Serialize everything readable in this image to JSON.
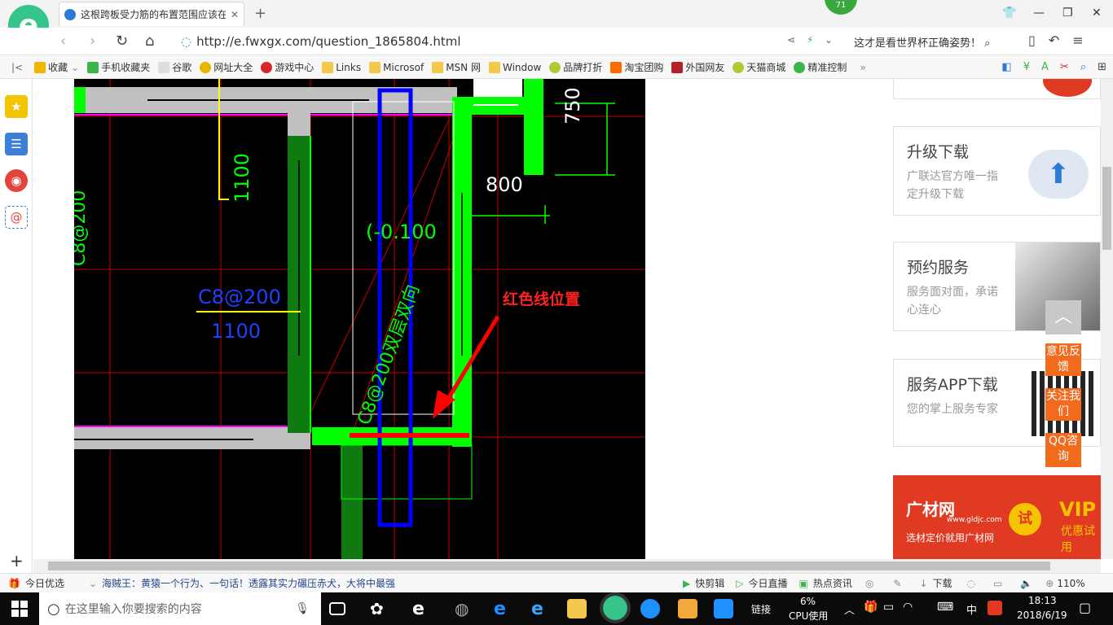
{
  "browser": {
    "tab_title": "这根跨板受力筋的布置范围应该在",
    "new_tab": "+",
    "badge": "71",
    "url": "http://e.fwxgx.com/question_1865804.html",
    "news_ticker": "这才是看世界杯正确姿势！"
  },
  "bookmarks": [
    {
      "label": "收藏",
      "color": "#f1b500"
    },
    {
      "label": "手机收藏夹",
      "color": "#3bb54a"
    },
    {
      "label": "谷歌",
      "color": "#dddddd"
    },
    {
      "label": "网址大全",
      "color": "#e6b600"
    },
    {
      "label": "游戏中心",
      "color": "#d9262c"
    },
    {
      "label": "Links",
      "color": "#f2c94c"
    },
    {
      "label": "Microsof",
      "color": "#f2c94c"
    },
    {
      "label": "MSN 网",
      "color": "#f2c94c"
    },
    {
      "label": "Window",
      "color": "#f2c94c"
    },
    {
      "label": "品牌打折",
      "color": "#b0c935"
    },
    {
      "label": "淘宝团购",
      "color": "#ff6a00"
    },
    {
      "label": "外国网友",
      "color": "#b3222b"
    },
    {
      "label": "天猫商城",
      "color": "#b0c935"
    },
    {
      "label": "精准控制",
      "color": "#3bb54a"
    }
  ],
  "cad": {
    "labels": {
      "dim_750": "750",
      "dim_800": "800",
      "dim_1100_vertical": "1100",
      "elev": "(-0.100",
      "c8_200": "C8@200",
      "dim_1100": "1100",
      "c8_200_left": "C8@200",
      "diag": "C8@200双层双向",
      "annotation": "红色线位置"
    },
    "colors": {
      "beam": "#c0c0c0",
      "column": "#00ff00",
      "dark_column": "#0f7a0f",
      "blue": "#0000ff",
      "red": "#ff0000",
      "yellow": "#ffff00"
    }
  },
  "right_panel": {
    "upgrade": {
      "title": "升级下载",
      "desc": "广联达官方唯一指定升级下载"
    },
    "booking": {
      "title": "预约服务",
      "desc": "服务面对面，承诺心连心"
    },
    "app": {
      "title": "服务APP下载",
      "desc": "您的掌上服务专家"
    },
    "ad": {
      "brand": "广材网",
      "url": "www.gldjc.com",
      "slogan": "选材定价就用广材网",
      "try": "试",
      "vip": "VIP",
      "vip_sub": "优惠试用"
    },
    "floats": {
      "feedback": "意见反馈",
      "follow": "关注我们",
      "qq": "QQ咨询"
    }
  },
  "status_bar": {
    "today": "今日优选",
    "headline": "海贼王：黄猿一个行为、一句话！透露其实力碾压赤犬，大将中最强",
    "quick_edit": "快剪辑",
    "live": "今日直播",
    "hot": "热点资讯",
    "download": "下载",
    "zoom": "110%"
  },
  "taskbar": {
    "search_placeholder": "在这里输入你要搜索的内容",
    "link": "链接",
    "cpu_percent": "6%",
    "cpu_label": "CPU使用",
    "ime": "中",
    "time": "18:13",
    "date": "2018/6/19"
  }
}
